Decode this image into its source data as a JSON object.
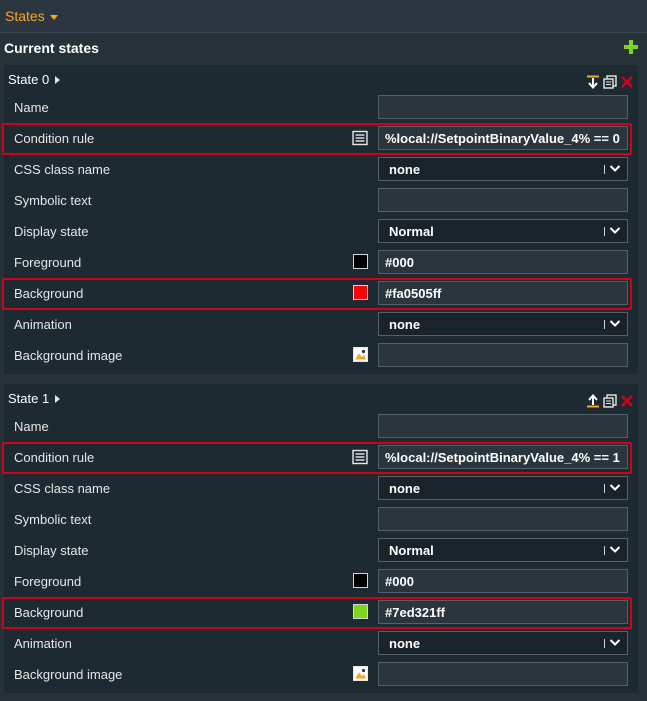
{
  "header": {
    "states_label": "States",
    "current_states_label": "Current states"
  },
  "colors": {
    "accent": "#f5a623",
    "add": "#7ed321",
    "remove": "#d0021b",
    "highlight": "#d0021b"
  },
  "states": [
    {
      "title": "State 0",
      "tool_icons": [
        "move-down-icon",
        "duplicate-icon",
        "delete-icon"
      ],
      "fields": {
        "name": {
          "label": "Name",
          "value": ""
        },
        "condition_rule": {
          "label": "Condition rule",
          "value": "%local://SetpointBinaryValue_4% == 0"
        },
        "css_class_name": {
          "label": "CSS class name",
          "value": "none"
        },
        "symbolic_text": {
          "label": "Symbolic text",
          "value": ""
        },
        "display_state": {
          "label": "Display state",
          "value": "Normal"
        },
        "foreground": {
          "label": "Foreground",
          "value": "#000",
          "swatch": "#000000"
        },
        "background": {
          "label": "Background",
          "value": "#fa0505ff",
          "swatch": "#fa0505"
        },
        "animation": {
          "label": "Animation",
          "value": "none"
        },
        "background_image": {
          "label": "Background image",
          "value": ""
        }
      }
    },
    {
      "title": "State 1",
      "tool_icons": [
        "move-up-icon",
        "duplicate-icon",
        "delete-icon"
      ],
      "fields": {
        "name": {
          "label": "Name",
          "value": ""
        },
        "condition_rule": {
          "label": "Condition rule",
          "value": "%local://SetpointBinaryValue_4% == 1"
        },
        "css_class_name": {
          "label": "CSS class name",
          "value": "none"
        },
        "symbolic_text": {
          "label": "Symbolic text",
          "value": ""
        },
        "display_state": {
          "label": "Display state",
          "value": "Normal"
        },
        "foreground": {
          "label": "Foreground",
          "value": "#000",
          "swatch": "#000000"
        },
        "background": {
          "label": "Background",
          "value": "#7ed321ff",
          "swatch": "#7ed321"
        },
        "animation": {
          "label": "Animation",
          "value": "none"
        },
        "background_image": {
          "label": "Background image",
          "value": ""
        }
      }
    }
  ]
}
